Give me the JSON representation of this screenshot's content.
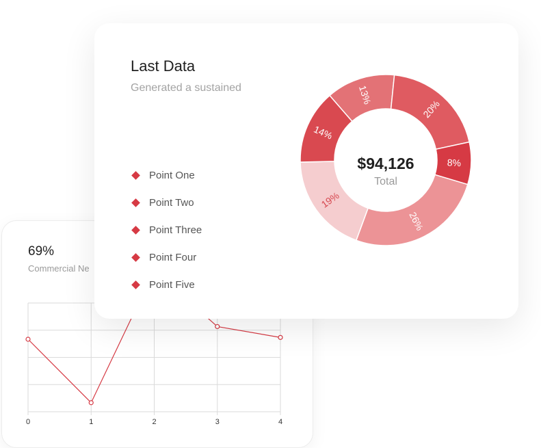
{
  "stats_card": {
    "value": "69%",
    "label": "Commercial Ne"
  },
  "main_card": {
    "title": "Last Data",
    "subtitle": "Generated a sustained",
    "legend": [
      "Point One",
      "Point Two",
      "Point Three",
      "Point Four",
      "Point Five"
    ],
    "center_value": "$94,126",
    "center_label": "Total"
  },
  "colors": {
    "accent": "#d63a44",
    "grid": "#dadada"
  },
  "chart_data": [
    {
      "type": "pie",
      "donut": true,
      "slices": [
        {
          "label": "13%",
          "value": 13,
          "color": "#e37276"
        },
        {
          "label": "20%",
          "value": 20,
          "color": "#df5b61"
        },
        {
          "label": "8%",
          "value": 8,
          "color": "#d63a44"
        },
        {
          "label": "26%",
          "value": 26,
          "color": "#ec9396"
        },
        {
          "label": "19%",
          "value": 19,
          "color": "#f5cdcf"
        },
        {
          "label": "14%",
          "value": 14,
          "color": "#d94950"
        }
      ]
    },
    {
      "type": "line",
      "x": [
        0,
        1,
        2,
        3,
        4
      ],
      "y": [
        70,
        35,
        108,
        77,
        71
      ],
      "ylim": [
        30,
        90
      ],
      "xlim": [
        0,
        4
      ],
      "tick_labels": [
        "0",
        "1",
        "2",
        "3",
        "4"
      ],
      "grid": true
    }
  ]
}
